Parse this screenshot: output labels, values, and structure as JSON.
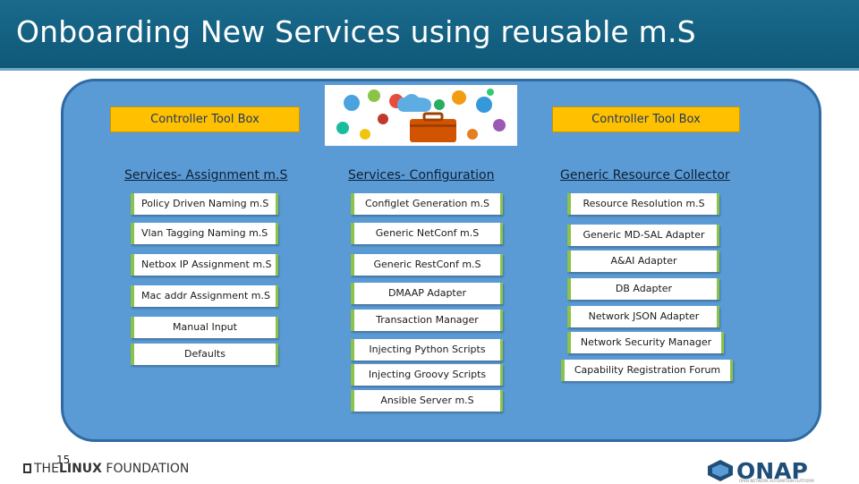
{
  "header": {
    "title": "Onboarding New Services using reusable m.S"
  },
  "toolboxes": {
    "left": "Controller Tool Box",
    "right": "Controller Tool Box"
  },
  "columns": {
    "assignment": {
      "heading": "Services- Assignment m.S",
      "items": [
        "Policy Driven Naming m.S",
        "Vlan Tagging Naming m.S",
        "Netbox IP Assignment m.S",
        "Mac addr Assignment m.S",
        "Manual Input",
        "Defaults"
      ]
    },
    "configuration": {
      "heading": "Services- Configuration",
      "items": [
        "Configlet Generation m.S",
        "Generic NetConf m.S",
        "Generic RestConf m.S",
        "DMAAP Adapter",
        "Transaction Manager",
        "Injecting Python Scripts",
        "Injecting Groovy Scripts",
        "Ansible Server m.S"
      ]
    },
    "resource": {
      "heading": "Generic Resource Collector",
      "items": [
        "Resource Resolution m.S",
        "Generic MD-SAL Adapter",
        "A&AI Adapter",
        "DB Adapter",
        "Network JSON Adapter",
        "Network Security Manager",
        "Capability Registration Forum"
      ]
    }
  },
  "footer": {
    "page_number": "15",
    "linux_the": "THE",
    "linux_bold": "LINUX",
    "linux_rest": " FOUNDATION",
    "onap": "ONAP",
    "onap_sub": "OPEN NETWORK AUTOMATION PLATFORM"
  },
  "colors": {
    "header": "#0f5878",
    "panel": "#5b9bd5",
    "toolbox": "#ffc000",
    "item_border": "#8bc34a"
  },
  "icons": [
    "toolbox-icon",
    "gear-icon",
    "chart-icon",
    "people-icon",
    "cloud-icon"
  ]
}
